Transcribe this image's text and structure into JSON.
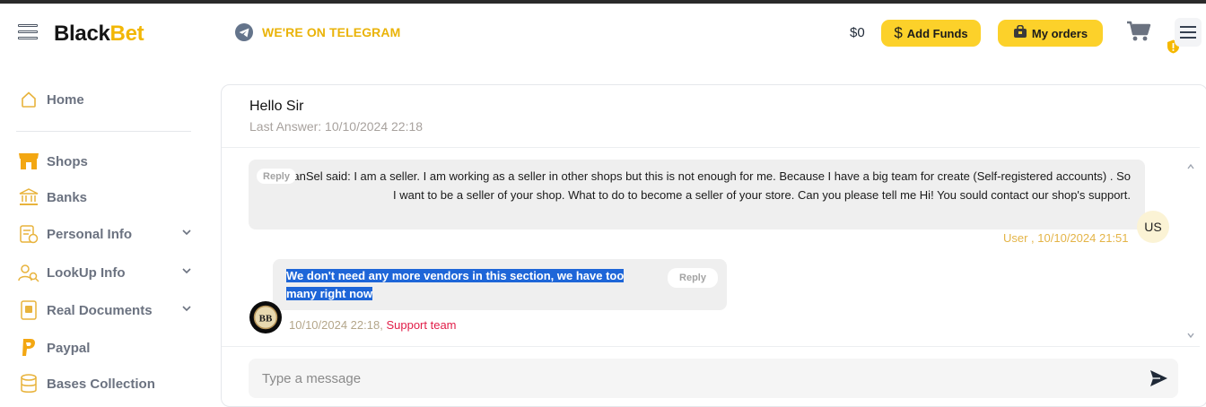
{
  "header": {
    "brand_part1": "Black",
    "brand_part2": "Bet",
    "telegram_label": "WE'RE ON TELEGRAM",
    "balance": "$0",
    "add_funds_label": "Add Funds",
    "my_orders_label": "My orders",
    "accent_color": "#fcd12a"
  },
  "sidebar": {
    "items": [
      {
        "label": "Home",
        "icon": "home-icon"
      },
      {
        "label": "Shops",
        "icon": "shop-icon"
      },
      {
        "label": "Banks",
        "icon": "bank-icon"
      },
      {
        "label": "Personal Info",
        "icon": "personal-info-icon",
        "expandable": true
      },
      {
        "label": "LookUp Info",
        "icon": "lookup-icon",
        "expandable": true
      },
      {
        "label": "Real Documents",
        "icon": "documents-icon",
        "expandable": true
      },
      {
        "label": "Paypal",
        "icon": "paypal-icon"
      },
      {
        "label": "Bases Collection",
        "icon": "database-icon"
      }
    ]
  },
  "ticket": {
    "title": "Hello Sir",
    "last_answer": "Last Answer: 10/10/2024 22:18"
  },
  "messages": {
    "user": {
      "reply_label": "Reply",
      "text": "UsBanSel said: I am a seller. I am working as a seller in other shops but this is not enough for me. Because I have a big team for create (Self-registered accounts) . So I want to be a seller of your shop. What to do to become a seller of your store. Can you please tell me Hi! You sould contact our shop's support.",
      "avatar_initials": "US",
      "meta": "User , 10/10/2024 21:51"
    },
    "support": {
      "text": "We don't need any more vendors in this section, we have too many right now",
      "reply_label": "Reply",
      "avatar_initials": "BB",
      "meta_time": "10/10/2024 22:18,",
      "meta_team": "Support team"
    }
  },
  "composer": {
    "placeholder": "Type a message"
  }
}
